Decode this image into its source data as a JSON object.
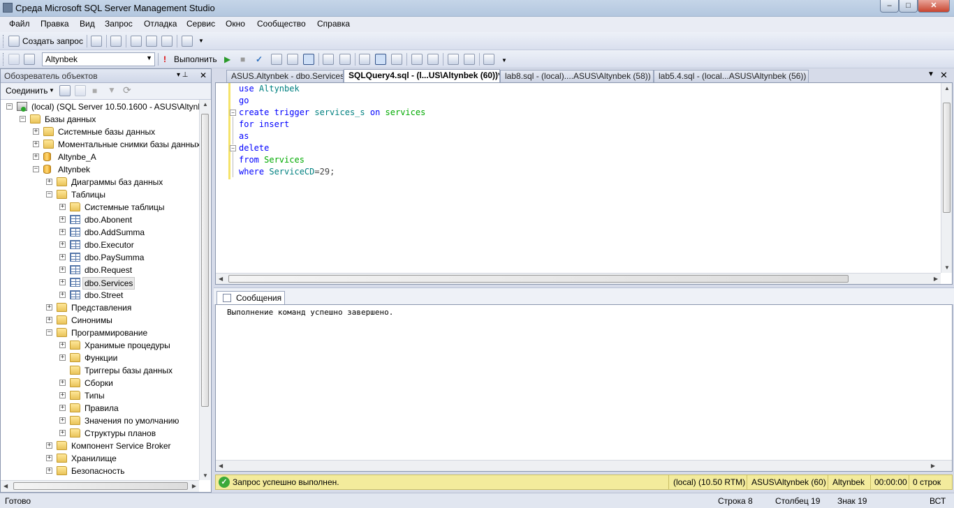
{
  "window": {
    "title": "Среда Microsoft SQL Server Management Studio",
    "minimize": "–",
    "maximize": "□",
    "close": "✕"
  },
  "menu": [
    "Файл",
    "Правка",
    "Вид",
    "Запрос",
    "Отладка",
    "Сервис",
    "Окно",
    "Сообщество",
    "Справка"
  ],
  "toolbar1": {
    "new_query": "Создать запрос"
  },
  "toolbar2": {
    "database": "Altynbek",
    "execute": "Выполнить"
  },
  "object_explorer": {
    "title": "Обозреватель объектов",
    "connect": "Соединить",
    "pin": "▾ ⊥",
    "close": "✕",
    "nodes": [
      {
        "label": "(local) (SQL Server 10.50.1600 - ASUS\\Altynbek)",
        "icon": "server-icon",
        "exp": "-"
      },
      {
        "label": "Базы данных",
        "icon": "folder-icon",
        "exp": "-"
      },
      {
        "label": "Системные базы данных",
        "icon": "folder-icon",
        "exp": "+"
      },
      {
        "label": "Моментальные снимки базы данных",
        "icon": "folder-icon",
        "exp": "+"
      },
      {
        "label": "Altynbe_A",
        "icon": "database-icon",
        "exp": "+"
      },
      {
        "label": "Altynbek",
        "icon": "database-icon",
        "exp": "-"
      },
      {
        "label": "Диаграммы баз данных",
        "icon": "folder-icon",
        "exp": "+"
      },
      {
        "label": "Таблицы",
        "icon": "folder-icon",
        "exp": "-"
      },
      {
        "label": "Системные таблицы",
        "icon": "folder-icon",
        "exp": "+"
      },
      {
        "label": "dbo.Abonent",
        "icon": "table-icon",
        "exp": "+"
      },
      {
        "label": "dbo.AddSumma",
        "icon": "table-icon",
        "exp": "+"
      },
      {
        "label": "dbo.Executor",
        "icon": "table-icon",
        "exp": "+"
      },
      {
        "label": "dbo.PaySumma",
        "icon": "table-icon",
        "exp": "+"
      },
      {
        "label": "dbo.Request",
        "icon": "table-icon",
        "exp": "+"
      },
      {
        "label": "dbo.Services",
        "icon": "table-icon",
        "exp": "+"
      },
      {
        "label": "dbo.Street",
        "icon": "table-icon",
        "exp": "+"
      },
      {
        "label": "Представления",
        "icon": "folder-icon",
        "exp": "+"
      },
      {
        "label": "Синонимы",
        "icon": "folder-icon",
        "exp": "+"
      },
      {
        "label": "Программирование",
        "icon": "folder-icon",
        "exp": "-"
      },
      {
        "label": "Хранимые процедуры",
        "icon": "folder-icon",
        "exp": "+"
      },
      {
        "label": "Функции",
        "icon": "folder-icon",
        "exp": "+"
      },
      {
        "label": "Триггеры базы данных",
        "icon": "folder-icon",
        "exp": ""
      },
      {
        "label": "Сборки",
        "icon": "folder-icon",
        "exp": "+"
      },
      {
        "label": "Типы",
        "icon": "folder-icon",
        "exp": "+"
      },
      {
        "label": "Правила",
        "icon": "folder-icon",
        "exp": "+"
      },
      {
        "label": "Значения по умолчанию",
        "icon": "folder-icon",
        "exp": "+"
      },
      {
        "label": "Структуры планов",
        "icon": "folder-icon",
        "exp": "+"
      },
      {
        "label": "Компонент Service Broker",
        "icon": "folder-icon",
        "exp": "+"
      },
      {
        "label": "Хранилище",
        "icon": "folder-icon",
        "exp": "+"
      },
      {
        "label": "Безопасность",
        "icon": "folder-icon",
        "exp": "+"
      }
    ]
  },
  "tabs": [
    "ASUS.Altynbek - dbo.Services",
    "SQLQuery4.sql - (l...US\\Altynbek (60))*",
    "lab8.sql - (local)....ASUS\\Altynbek (58))",
    "lab5.4.sql - (local...ASUS\\Altynbek (56))"
  ],
  "code": {
    "l1a": "use ",
    "l1b": "Altynbek",
    "l2": "go",
    "l3a": "create trigger ",
    "l3b": "services_s",
    "l3c": " on ",
    "l3d": "services",
    "l4": "for insert",
    "l5": "as",
    "l6": "delete",
    "l7a": "from ",
    "l7b": "Services",
    "l8a": "where ",
    "l8b": "ServiceCD",
    "l8c": "=29;"
  },
  "results": {
    "tab": "Сообщения",
    "message": "Выполнение команд успешно завершено."
  },
  "query_status": {
    "status": "Запрос успешно выполнен.",
    "server": "(local) (10.50 RTM)",
    "user": "ASUS\\Altynbek (60)",
    "database": "Altynbek",
    "time": "00:00:00",
    "rows": "0 строк"
  },
  "statusbar": {
    "ready": "Готово",
    "line": "Строка 8",
    "col": "Столбец 19",
    "ch": "Знак 19",
    "mode": "ВСТ"
  }
}
